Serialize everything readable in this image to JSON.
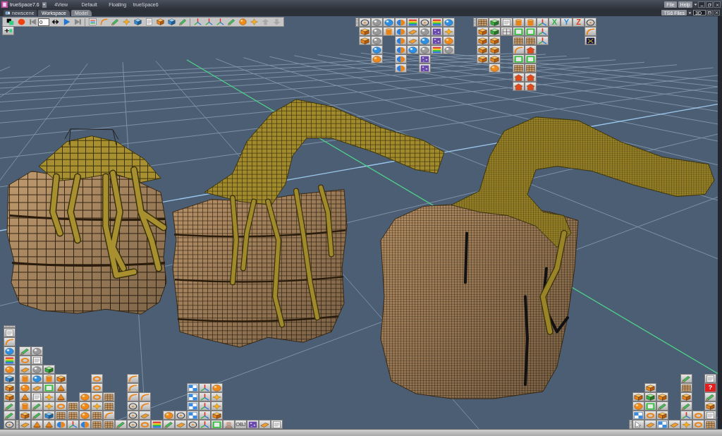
{
  "window": {
    "title": "trueSpace7.6",
    "layouts": [
      {
        "label": "4View"
      },
      {
        "label": "Default"
      },
      {
        "label": "Floating"
      },
      {
        "label": "trueSpace6"
      }
    ],
    "menu": [
      "File",
      "Help"
    ]
  },
  "scene_tab": {
    "label": "newscene"
  },
  "tabs": [
    {
      "label": "Workspace",
      "selected": true
    },
    {
      "label": "Model",
      "selected": false
    }
  ],
  "library": {
    "label": "TS6 Files"
  },
  "view": {
    "value": "3D"
  },
  "toolbar": {
    "frame": "0",
    "arrow_buttons": [
      {
        "disabled": true
      },
      {
        "disabled": true
      }
    ]
  },
  "axis_buttons": [
    {
      "label": "X",
      "color": "#2fb24a"
    },
    {
      "label": "Y",
      "color": "#2a8ad8"
    },
    {
      "label": "Z",
      "color": "#e0401a"
    }
  ],
  "tile_labels": [
    {
      "kind": "format",
      "label": "OBJ"
    },
    {
      "kind": "help",
      "label": "?"
    }
  ]
}
